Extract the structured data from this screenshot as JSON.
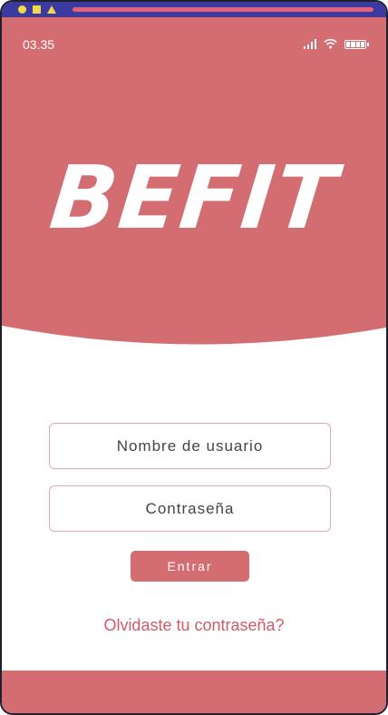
{
  "status_bar": {
    "time": "03.35",
    "icons": [
      "signal-icon",
      "wifi-icon",
      "battery-icon"
    ]
  },
  "app": {
    "logo_text": "BEFIT"
  },
  "login": {
    "username_placeholder": "Nombre de usuario",
    "password_placeholder": "Contraseña",
    "submit_label": "Entrar",
    "forgot_link": "Olvidaste tu contraseña?"
  },
  "colors": {
    "primary": "#d46d72",
    "input_border": "#e7a6b2",
    "link": "#d25a68",
    "frame_bar": "#3a3aa0",
    "frame_accent": "#f4d64a",
    "frame_line": "#e2627a"
  }
}
